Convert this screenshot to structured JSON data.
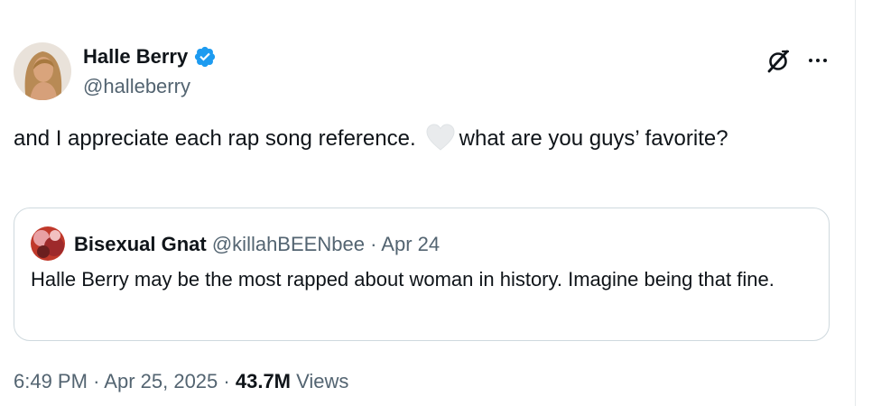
{
  "author": {
    "display_name": "Halle Berry",
    "handle": "@halleberry",
    "verified": true,
    "verified_color": "#1d9bf0"
  },
  "tweet": {
    "text_before_emoji": "and I appreciate each rap song reference.",
    "emoji": "white-heart",
    "text_after_emoji": "what are you guys’ favorite?"
  },
  "quoted_tweet": {
    "display_name": "Bisexual Gnat",
    "handle": "@killahBEENbee",
    "separator": "·",
    "date": "Apr 24",
    "text": "Halle Berry may be the most rapped about woman in history. Imagine being that fine."
  },
  "meta": {
    "time": "6:49 PM",
    "separator": "·",
    "date": "Apr 25, 2025",
    "views_count": "43.7M",
    "views_label": "Views"
  },
  "icons": {
    "more": "more-horizontal-icon",
    "grok": "grok-icon"
  }
}
